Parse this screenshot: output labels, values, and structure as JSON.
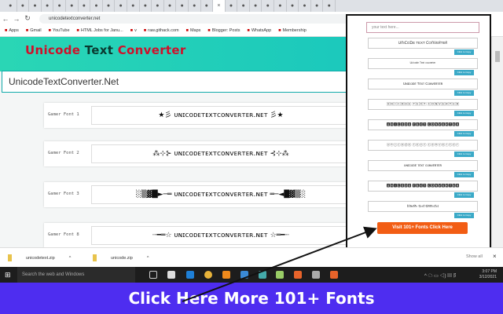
{
  "browser": {
    "url": "unicodetextconverter.net",
    "tab_count": 27,
    "bookmarks": [
      "Apps",
      "Gmail",
      "YouTube",
      "HTML Jobs for Janu...",
      "v",
      "raw.githack.com",
      "Maps",
      "Blogger: Posts",
      "WhatsApp",
      "Membership"
    ]
  },
  "header": {
    "title_part1": "Unicode",
    "title_part2": "Text",
    "title_part3": "Converter"
  },
  "main_input": {
    "value": "UnicodeTextConverter.Net"
  },
  "fonts": [
    {
      "label": "Gamer Font 1",
      "value": "★彡 ᴜɴɪᴄᴏᴅᴇᴛᴇxᴛᴄᴏɴᴠᴇʀᴛᴇʀ.ɴᴇᴛ 彡★"
    },
    {
      "label": "Gamer Font 2",
      "value": "⁂⊹⊱ ᴜɴɪᴄᴏᴅᴇᴛᴇxᴛᴄᴏɴᴠᴇʀᴛᴇʀ.ɴᴇᴛ ⊰⊹⁂"
    },
    {
      "label": "Gamer Font 3",
      "value": "░▒▓█►─═ ᴜɴɪᴄᴏᴅᴇᴛᴇxᴛᴄᴏɴᴠᴇʀᴛᴇʀ.ɴᴇᴛ ═─◄█▓▒░"
    },
    {
      "label": "Gamer Font 8",
      "value": "┈━═☆ ᴜɴɪᴄᴏᴅᴇᴛᴇxᴛᴄᴏɴᴠᴇʀᴛᴇʀ.ɴᴇᴛ ☆═━┈"
    }
  ],
  "popup": {
    "placeholder": "your text here...",
    "copy_label": "Click to Copy",
    "items": [
      "ᑌᑎIᑕOᗪE TEXT ᑕOᑎᐯEᖇTEᖇ",
      "ᵁⁿⁱᶜᵒᵈᵉ ᵀᵉˣᵗ ᶜᵒⁿᵛᵉʳᵗᵉʳ",
      "Uɴɪᴄᴏᴅᴇ Tᴇxᴛ Cᴏɴᴠᴇʀᴛᴇʀ",
      "🅄🄽🄸🄲🄾🄳🄴 🅃🄴🅇🅃 🄲🄾🄽🅅🄴🅁🅃🄴🅁",
      "🆄🅽🅸🅲🅾🅳🅴 🆃🅴🆇🆃 🅲🅾🅽🆅🅴🆁🆃🅴🆁",
      "ⓤⓝⓘⓒⓞⓓⓔ ⓣⓔⓧⓣ ⓒⓞⓝⓥⓔⓡⓣⓔⓡ",
      "ᴜɴɪᴄᴏᴅᴇ ᴛᴇxᴛ ᴄᴏɴᴠᴇʀᴛᴇʀ",
      "🆄🅽🅸🅲🅾🅳🅴 🆃🅴🆇🆃 🅲🅾🅽🆅🅴🆁🆃🅴🆁",
      "𝔘𝔫𝔦𝔠𝔬𝔡𝔢 𝔗𝔢𝔵𝔱 ℭ𝔬𝔫𝔳𝔢𝔯𝔱𝔢𝔯"
    ],
    "visit_button": "Visit 101+ Fonts Click Here"
  },
  "downloads": [
    {
      "name": "unicodetext.zip"
    },
    {
      "name": "unicode.zip"
    }
  ],
  "downloads_show_all": "Show all",
  "taskbar": {
    "search_placeholder": "Search the web and Windows",
    "time": "3:07 PM",
    "date": "3/12/2021"
  },
  "banner": {
    "text": "Click Here More 101+ Fonts"
  },
  "colors": {
    "accent": "#15c3bf",
    "banner": "#4e2df0",
    "button": "#f25d14"
  }
}
